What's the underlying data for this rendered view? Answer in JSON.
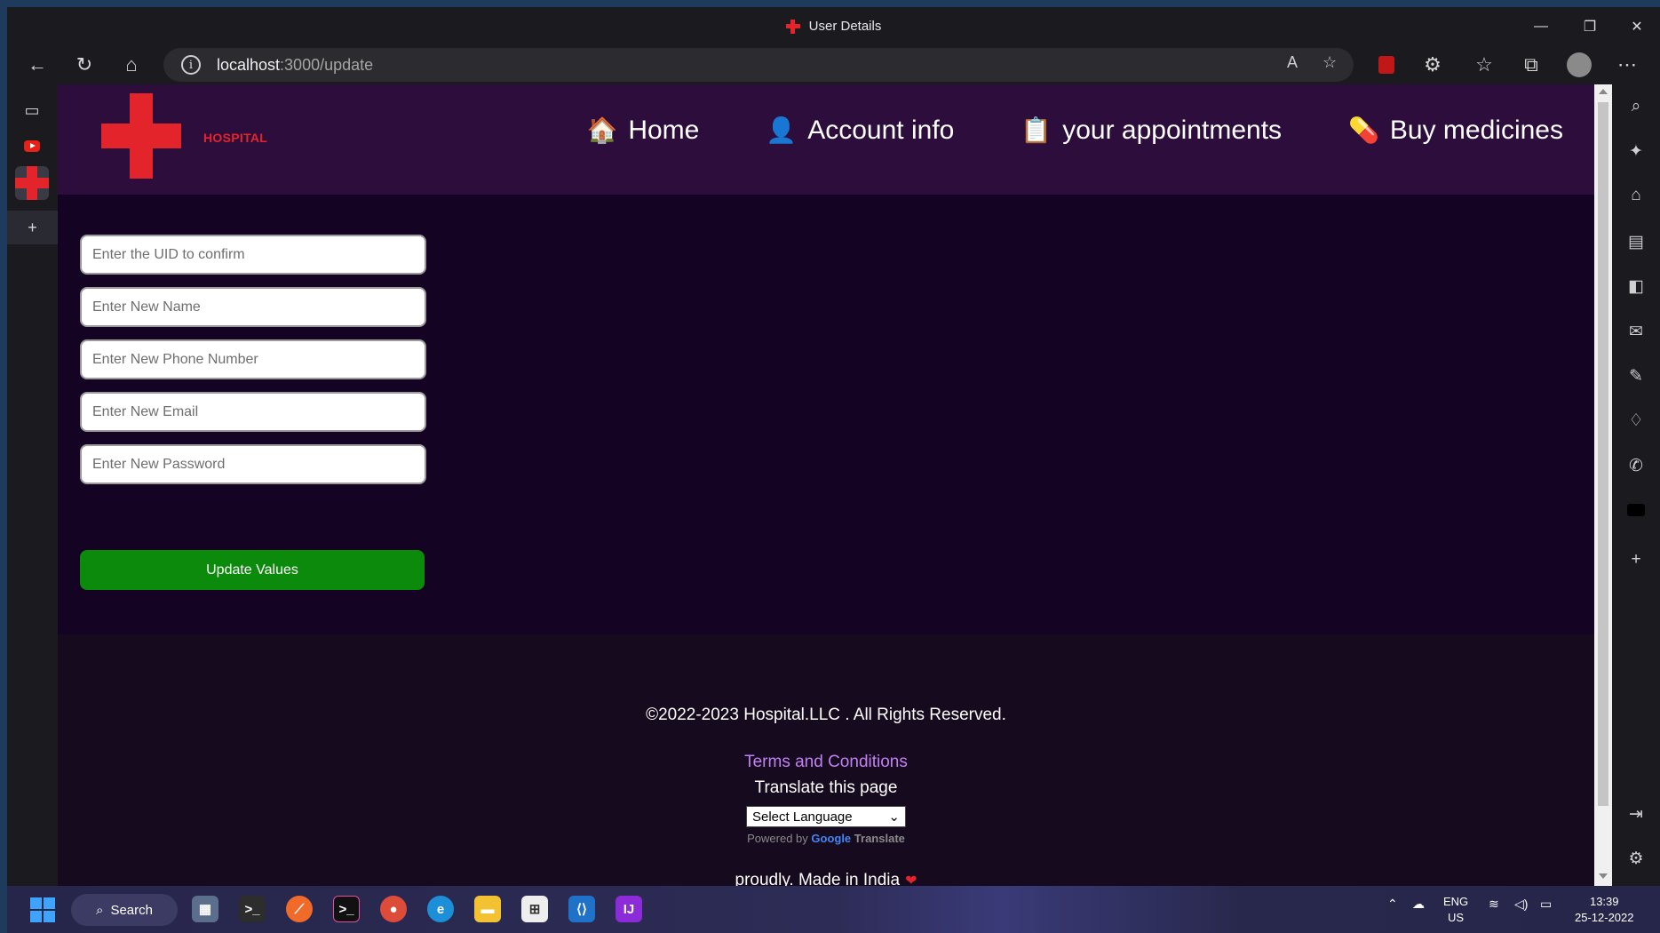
{
  "window": {
    "title": "User Details",
    "minimize": "—",
    "restore": "❐",
    "close": "✕"
  },
  "browser": {
    "url_host": "localhost",
    "url_path": ":3000/update"
  },
  "site": {
    "brand": "HOSPITAL",
    "nav": [
      {
        "icon": "🏠",
        "label": "Home"
      },
      {
        "icon": "👤",
        "label": "Account info"
      },
      {
        "icon": "📋",
        "label": "your appointments"
      },
      {
        "icon": "💊",
        "label": "Buy medicines"
      }
    ]
  },
  "form": {
    "uid_placeholder": "Enter the UID to confirm",
    "name_placeholder": "Enter New Name",
    "phone_placeholder": "Enter New Phone Number",
    "email_placeholder": "Enter New Email",
    "password_placeholder": "Enter New Password",
    "submit_label": "Update Values"
  },
  "footer": {
    "copyright": "©2022-2023 Hospital.LLC . All Rights Reserved.",
    "terms": "Terms and Conditions",
    "translate_title": "Translate this page",
    "language_select": "Select Language",
    "powered_by": "Powered by",
    "google": "Google",
    "translate": "Translate",
    "made_in": "proudly. Made in India"
  },
  "taskbar": {
    "search_label": "Search",
    "lang_line1": "ENG",
    "lang_line2": "US",
    "time": "13:39",
    "date": "25-12-2022"
  }
}
